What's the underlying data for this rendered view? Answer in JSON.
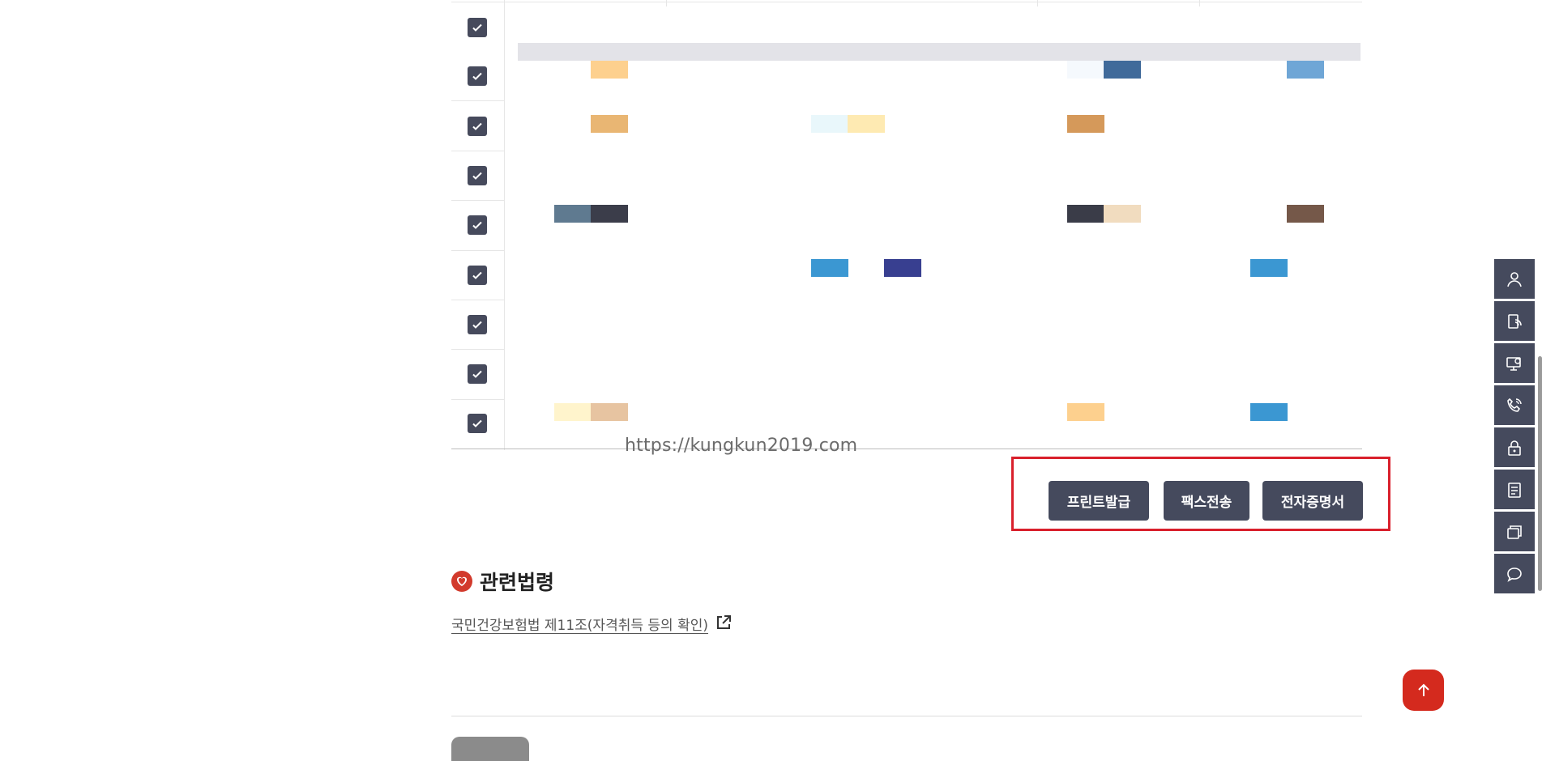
{
  "table": {
    "rows": [
      {
        "checked": true
      },
      {
        "checked": true
      },
      {
        "checked": true
      },
      {
        "checked": true
      },
      {
        "checked": true
      },
      {
        "checked": true
      },
      {
        "checked": true
      },
      {
        "checked": true
      },
      {
        "checked": true
      }
    ]
  },
  "watermark": "https://kungkun2019.com",
  "actions": {
    "print_label": "프린트발급",
    "fax_label": "팩스전송",
    "ecert_label": "전자증명서"
  },
  "related_law": {
    "title": "관련법령",
    "link_text": "국민건강보험법 제11조(자격취득 등의 확인)"
  },
  "quick_menu": {
    "icons": [
      "user-icon",
      "document-phone-icon",
      "monitor-icon",
      "phone-icon",
      "lock-icon",
      "document-icon",
      "windows-icon",
      "chat-icon"
    ]
  },
  "colors": {
    "button_bg": "#454a5d",
    "highlight_border": "#d9202c",
    "top_button": "#d42a1e",
    "section_icon": "#d23a2c"
  }
}
